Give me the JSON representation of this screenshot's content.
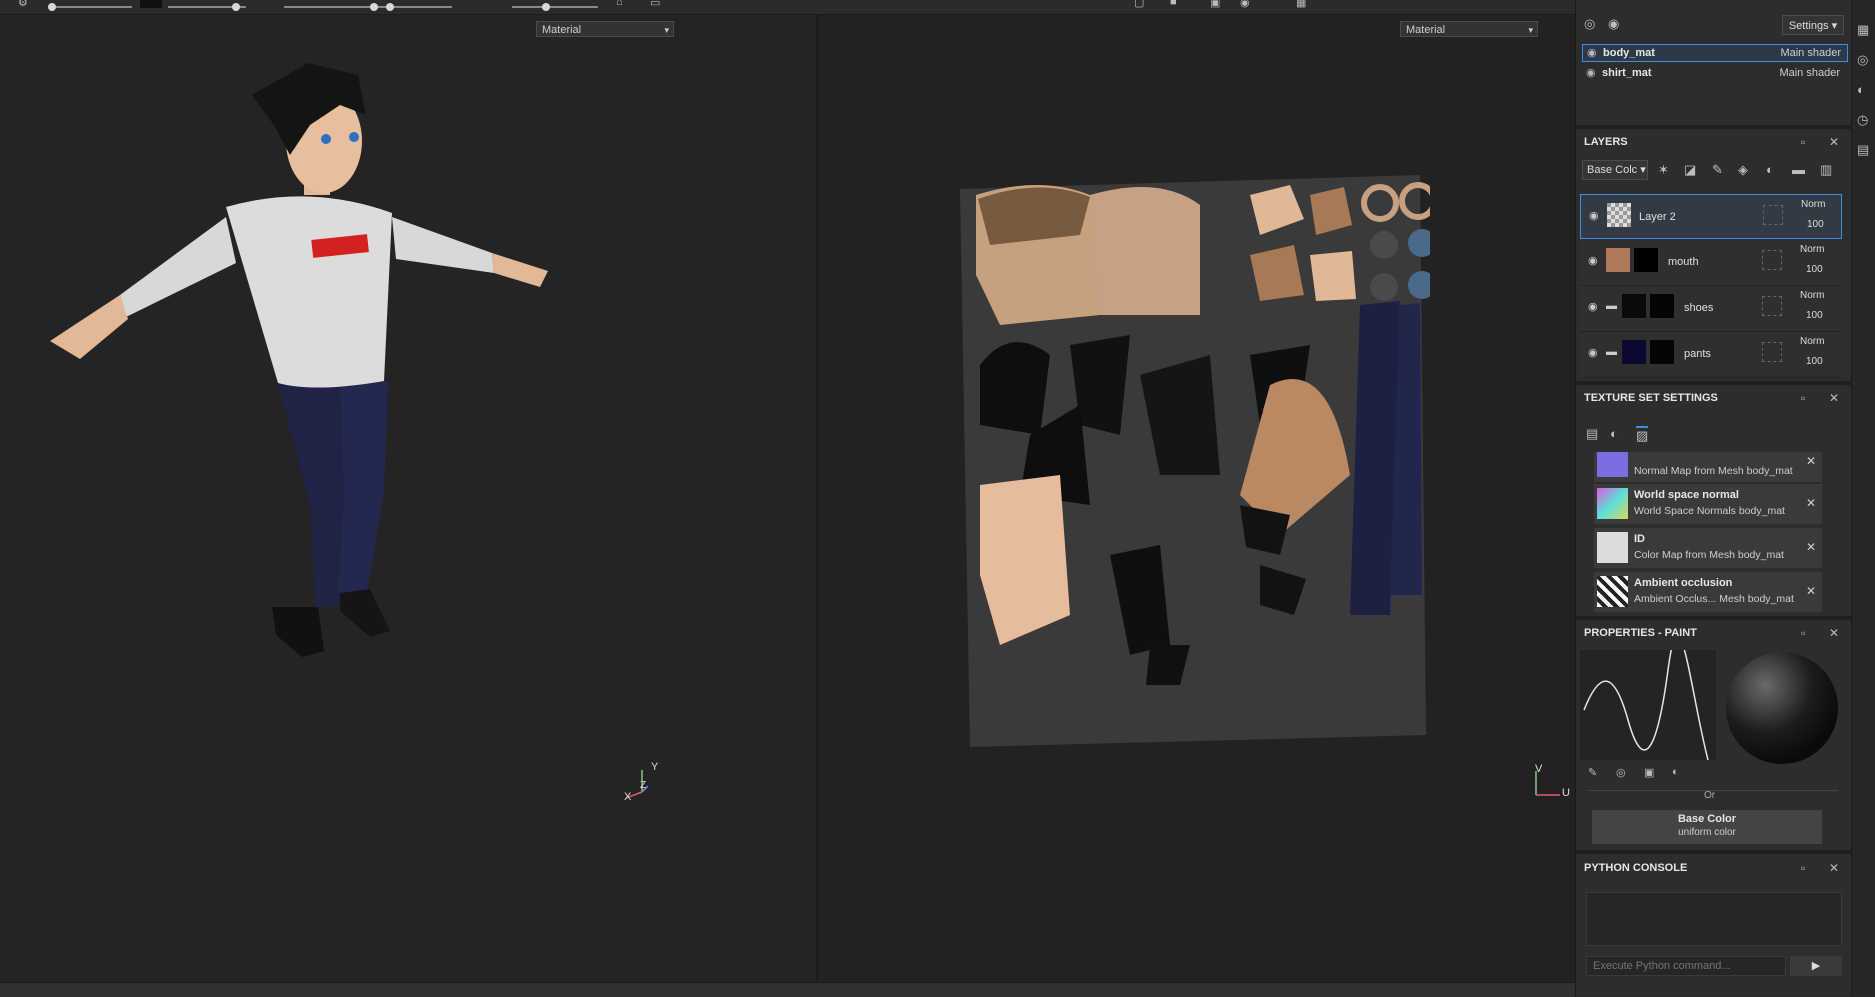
{
  "viewport3d": {
    "material_select": "Material"
  },
  "viewport2d": {
    "material_select": "Material"
  },
  "axes3d": {
    "x": "X",
    "y": "Y",
    "z": "Z"
  },
  "axes2d": {
    "v": "V",
    "u": "U"
  },
  "texture_set_list": {
    "settings_label": "Settings",
    "items": [
      {
        "name": "body_mat",
        "shader": "Main shader"
      },
      {
        "name": "shirt_mat",
        "shader": "Main shader"
      }
    ]
  },
  "layers": {
    "title": "LAYERS",
    "channel": "Base Colc",
    "items": [
      {
        "name": "Layer 2",
        "blend": "Norm",
        "opacity": "100"
      },
      {
        "name": "mouth",
        "blend": "Norm",
        "opacity": "100"
      },
      {
        "name": "shoes",
        "blend": "Norm",
        "opacity": "100"
      },
      {
        "name": "pants",
        "blend": "Norm",
        "opacity": "100"
      }
    ]
  },
  "texture_set_settings": {
    "title": "TEXTURE SET SETTINGS",
    "bakes": [
      {
        "title": "",
        "subtitle": "Normal Map from Mesh body_mat",
        "color": "#7a6ee0"
      },
      {
        "title": "World space normal",
        "subtitle": "World Space Normals body_mat",
        "color": "#c060c0"
      },
      {
        "title": "ID",
        "subtitle": "Color Map from Mesh body_mat",
        "color": "#dcdcdc"
      },
      {
        "title": "Ambient occlusion",
        "subtitle": "Ambient Occlus... Mesh body_mat",
        "color": "#e8e8e8"
      }
    ]
  },
  "properties_paint": {
    "title": "PROPERTIES - PAINT",
    "or_label": "Or",
    "base_color_label": "Base Color",
    "base_color_sub": "uniform color"
  },
  "python_console": {
    "title": "PYTHON CONSOLE",
    "placeholder": "Execute Python command..."
  }
}
